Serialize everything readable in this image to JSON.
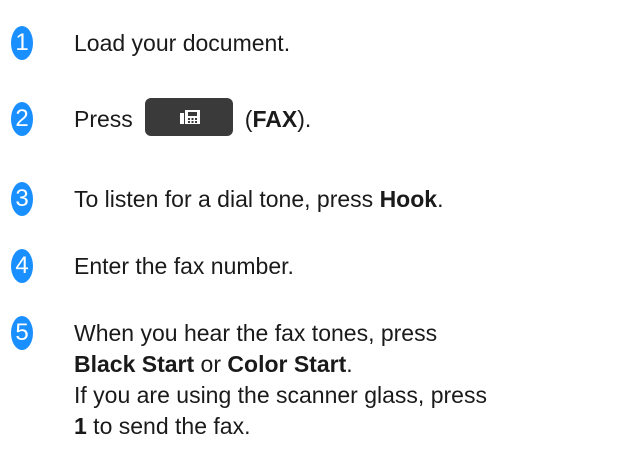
{
  "steps": [
    {
      "number": "1",
      "text": "Load your document."
    },
    {
      "number": "2",
      "prefix": "Press",
      "button_icon": "fax-icon",
      "open_paren": "(",
      "bold": "FAX",
      "close": ")."
    },
    {
      "number": "3",
      "text": "To listen for a dial tone, press ",
      "bold": "Hook",
      "close": "."
    },
    {
      "number": "4",
      "text": "Enter the fax number."
    },
    {
      "number": "5",
      "line1": "When you hear the fax tones, press",
      "bold_a": "Black Start",
      "mid": " or ",
      "bold_b": "Color Start",
      "end": ".",
      "line3": "If you are using the scanner glass, press",
      "bold_c": "1",
      "line4_rest": " to send the fax."
    }
  ],
  "colors": {
    "badge": "#1a8fff",
    "button": "#3a3a3a",
    "text": "#1a1a1a"
  }
}
